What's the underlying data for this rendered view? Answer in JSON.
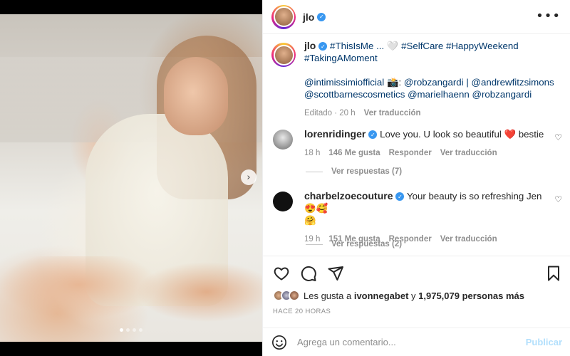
{
  "post": {
    "username": "jlo",
    "verified_symbol": "✓",
    "more_symbol": "•••",
    "media": {
      "slide_count": 4,
      "active_slide": 1,
      "next_symbol": "›"
    }
  },
  "caption": {
    "username": "jlo",
    "line1_tags": "#ThisIsMe ... ",
    "line1_heart": "🤍",
    "line1_more_tags": " #SelfCare #HappyWeekend",
    "line2": "#TakingAMoment",
    "credits_1a": "@intimissimiofficial",
    "credits_camera": " 📸: ",
    "credits_1b": "@robzangardi",
    "credits_sep": " | ",
    "credits_1c": "@andrewfitzsimons",
    "credits_2a": "@scottbarnescosmetics",
    "credits_2b": "@marielhaenn",
    "credits_2c": "@robzangardi",
    "edited": "Editado · 20 h",
    "translate": "Ver traducción"
  },
  "comments": [
    {
      "username": "lorenridinger",
      "text": "Love you. U look so beautiful ❤️ bestie",
      "time": "18 h",
      "likes": "146 Me gusta",
      "reply": "Responder",
      "translate": "Ver traducción",
      "replies": "Ver respuestas (7)",
      "heart_symbol": "♡"
    },
    {
      "username": "charbelzoecouture",
      "text": "Your beauty is so refreshing Jen😍🥰",
      "text2": "🤗",
      "time": "19 h",
      "likes": "151 Me gusta",
      "reply": "Responder",
      "translate": "Ver traducción",
      "replies": "Ver respuestas (2)",
      "heart_symbol": "♡"
    }
  ],
  "likes": {
    "prefix": "Les gusta a ",
    "user": "ivonnegabet",
    "middle": " y ",
    "count": "1,975,079 personas más"
  },
  "timestamp": "HACE 20 HORAS",
  "composer": {
    "placeholder": "Agrega un comentario...",
    "publish": "Publicar"
  },
  "colors": {
    "link": "#00376b",
    "verified": "#3897f0",
    "muted": "#8e8e8e",
    "publish_disabled": "#b2dffc"
  }
}
